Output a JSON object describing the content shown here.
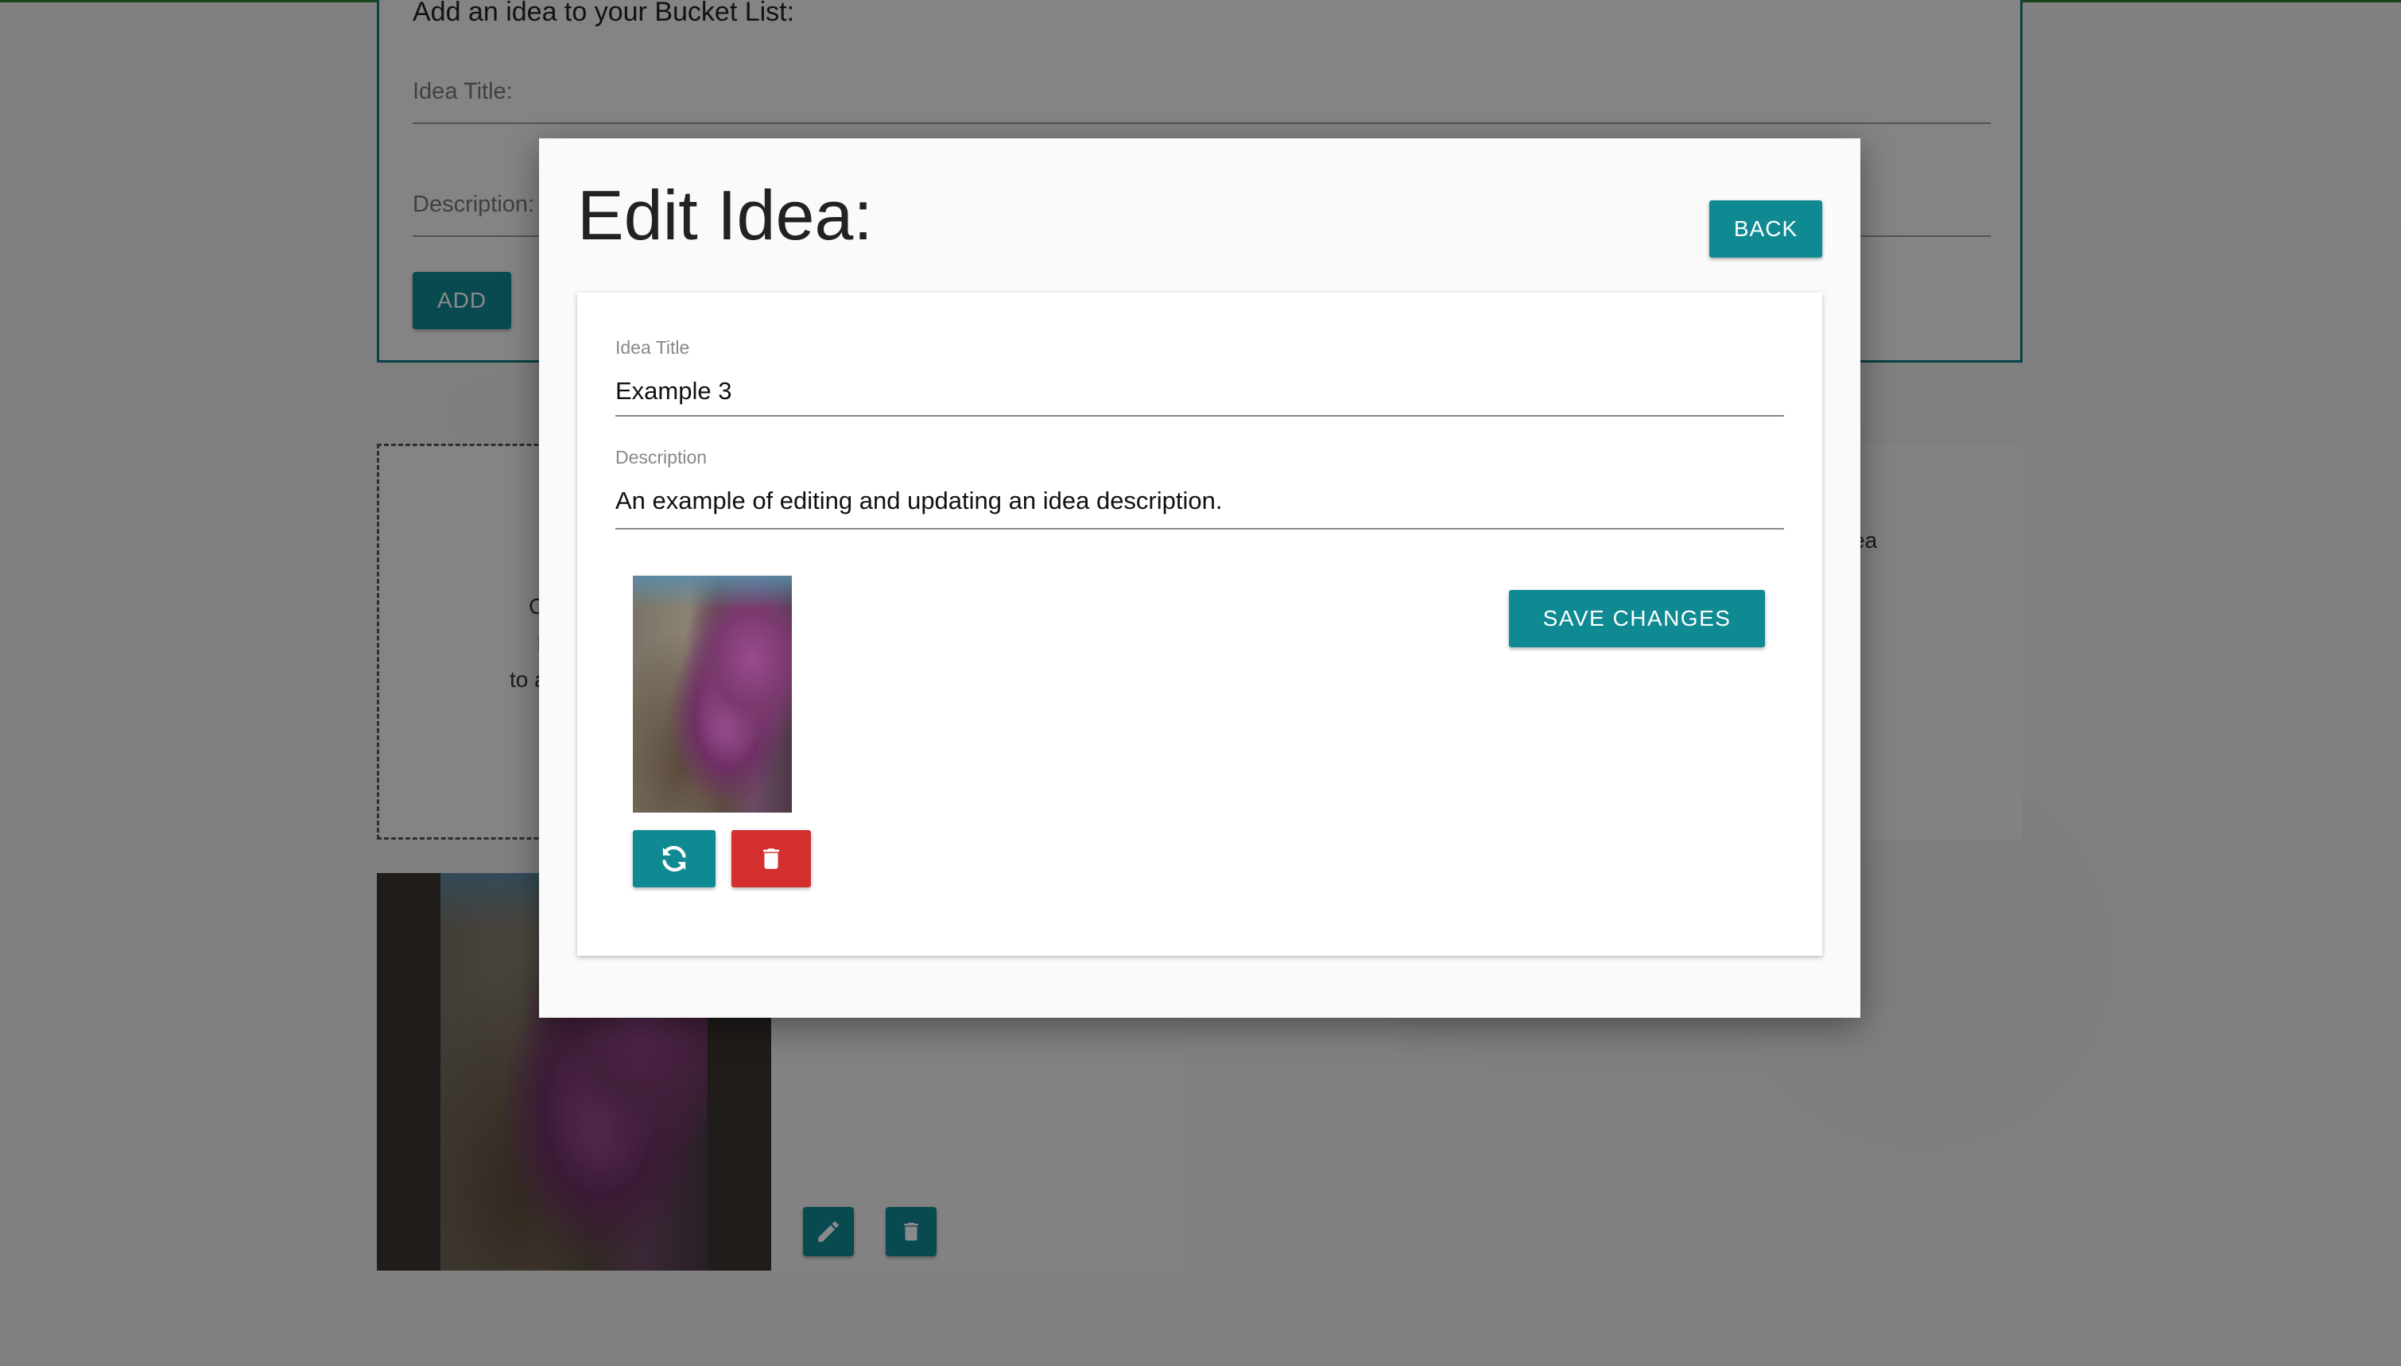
{
  "background": {
    "add_form": {
      "heading": "Add an idea to your Bucket List:",
      "title_placeholder": "Idea Title:",
      "description_placeholder": "Description:",
      "add_label": "ADD"
    },
    "dashed_card_fragments": [
      "C",
      "I",
      "to a"
    ],
    "right_card_fragment": "ea"
  },
  "modal": {
    "title": "Edit Idea:",
    "back_label": "BACK",
    "title_field": {
      "label": "Idea Title",
      "value": "Example 3"
    },
    "description_field": {
      "label": "Description",
      "value": "An example of editing and updating an idea description."
    },
    "save_label": "SAVE CHANGES",
    "icons": {
      "replace": "refresh-icon",
      "delete": "trash-icon"
    }
  },
  "colors": {
    "primary": "#0f8a93",
    "danger": "#d32f2f",
    "frame": "#0f7a80",
    "top_border": "#2e7d32"
  }
}
